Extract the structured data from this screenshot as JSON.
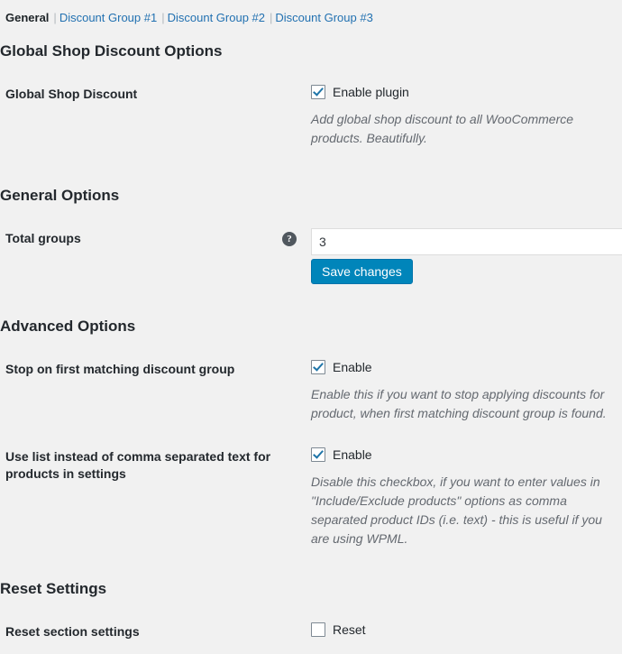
{
  "nav": {
    "separator": "|",
    "items": [
      {
        "label": "General",
        "current": true
      },
      {
        "label": "Discount Group #1",
        "current": false
      },
      {
        "label": "Discount Group #2",
        "current": false
      },
      {
        "label": "Discount Group #3",
        "current": false
      }
    ]
  },
  "sections": {
    "global": {
      "title": "Global Shop Discount Options",
      "row": {
        "label": "Global Shop Discount",
        "checkbox_label": "Enable plugin",
        "checked": true,
        "description": "Add global shop discount to all WooCommerce products. Beautifully."
      }
    },
    "general": {
      "title": "General Options",
      "row": {
        "label": "Total groups",
        "help_glyph": "?",
        "value": "3",
        "save_label": "Save changes"
      }
    },
    "advanced": {
      "title": "Advanced Options",
      "row1": {
        "label": "Stop on first matching discount group",
        "checkbox_label": "Enable",
        "checked": true,
        "description": "Enable this if you want to stop applying discounts for product, when first matching discount group is found."
      },
      "row2": {
        "label": "Use list instead of comma separated text for products in settings",
        "checkbox_label": "Enable",
        "checked": true,
        "description": "Disable this checkbox, if you want to enter values in \"Include/Exclude products\" options as comma separated product IDs (i.e. text) - this is useful if you are using WPML."
      }
    },
    "reset": {
      "title": "Reset Settings",
      "row": {
        "label": "Reset section settings",
        "checkbox_label": "Reset",
        "checked": false
      }
    }
  },
  "colors": {
    "accent": "#0085ba",
    "link": "#2271b1",
    "background": "#f1f1f1",
    "check": "#1e74a8"
  }
}
